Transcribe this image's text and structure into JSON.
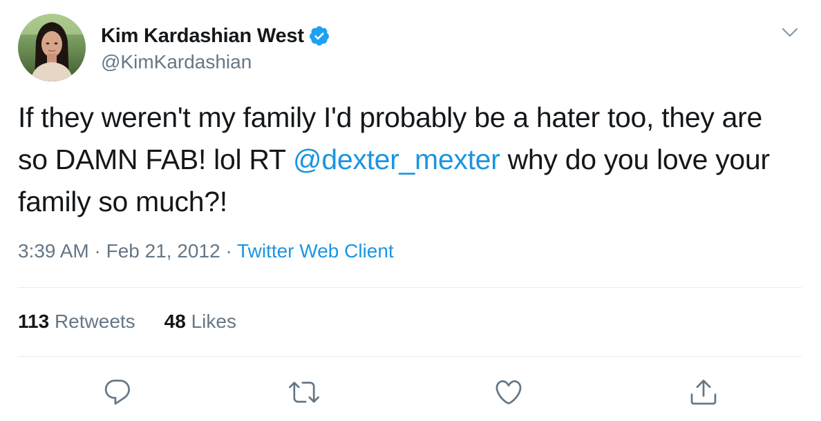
{
  "user": {
    "display_name": "Kim Kardashian West",
    "handle": "@KimKardashian",
    "verified": true
  },
  "tweet": {
    "text_before": "If they weren't my family I'd probably be a hater too, they are so DAMN FAB! lol RT ",
    "mention": "@dexter_mexter",
    "text_after": " why do you love your family so much?!"
  },
  "meta": {
    "time": "3:39 AM",
    "separator": "·",
    "date": "Feb 21, 2012",
    "source": "Twitter Web Client"
  },
  "stats": {
    "retweets_count": "113",
    "retweets_label": "Retweets",
    "likes_count": "48",
    "likes_label": "Likes"
  },
  "icons": {
    "verified": "verified-badge-icon",
    "more": "chevron-down-icon",
    "reply": "reply-icon",
    "retweet": "retweet-icon",
    "like": "heart-icon",
    "share": "share-icon"
  },
  "colors": {
    "link": "#1b95e0",
    "secondary_text": "#657786",
    "primary_text": "#14171a",
    "divider": "#e6ecf0"
  }
}
